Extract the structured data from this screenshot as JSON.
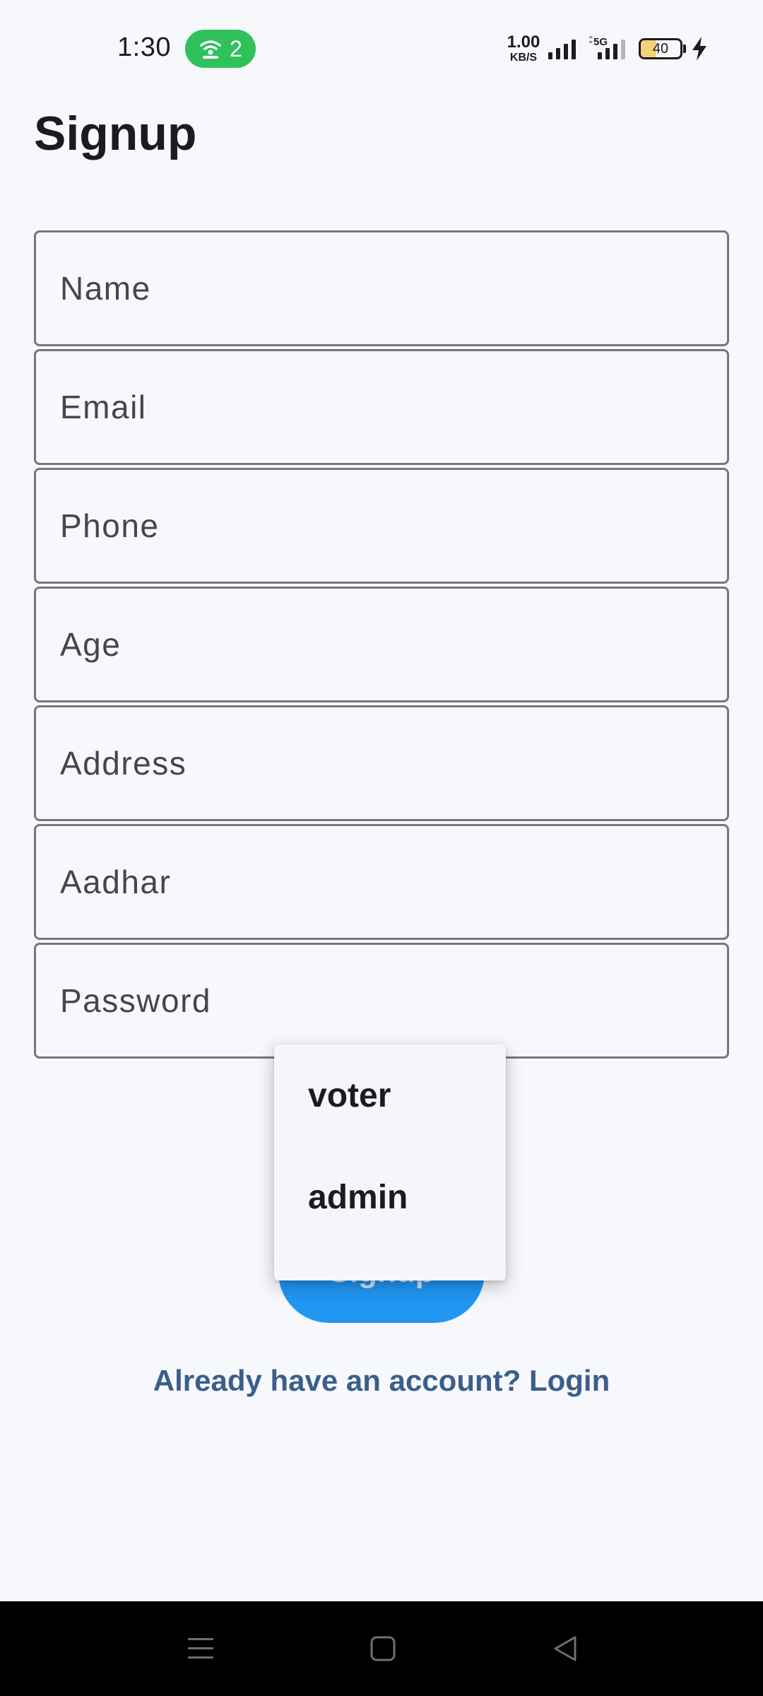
{
  "status_bar": {
    "time": "1:30",
    "hotspot_count": "2",
    "net_speed_value": "1.00",
    "net_speed_unit": "KB/S",
    "network_type": "5G",
    "battery_level": "40",
    "battery_fraction": 0.4,
    "icons": [
      "hotspot-icon",
      "signal-icon",
      "5g-signal-icon",
      "battery-icon",
      "charging-icon"
    ]
  },
  "page": {
    "title": "Signup"
  },
  "form": {
    "fields": [
      {
        "placeholder": "Name",
        "value": ""
      },
      {
        "placeholder": "Email",
        "value": ""
      },
      {
        "placeholder": "Phone",
        "value": ""
      },
      {
        "placeholder": "Age",
        "value": ""
      },
      {
        "placeholder": "Address",
        "value": ""
      },
      {
        "placeholder": "Aadhar",
        "value": ""
      },
      {
        "placeholder": "Password",
        "value": ""
      }
    ],
    "role_options": [
      "voter",
      "admin"
    ],
    "submit_label": "Signup"
  },
  "footer": {
    "login_link": "Already have an account? Login"
  },
  "navigation": {
    "icons": [
      "menu-icon",
      "home-icon",
      "back-icon"
    ]
  },
  "colors": {
    "background": "#f7f8fc",
    "primary": "#2196f3",
    "link": "#3a5f8a",
    "hotspot": "#2fc25b",
    "field_border": "#76777c"
  }
}
